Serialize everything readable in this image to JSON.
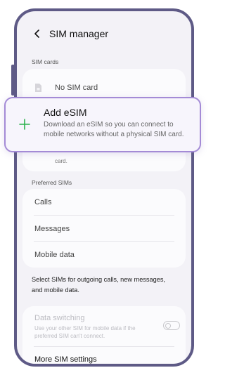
{
  "header": {
    "title": "SIM manager"
  },
  "sim_cards": {
    "section_label": "SIM cards",
    "no_sim_label": "No SIM card",
    "hidden_desc_tail": "card."
  },
  "add_esim": {
    "title": "Add eSIM",
    "description": "Download an eSIM so you can connect to mobile networks without a physical SIM card.",
    "accent_color": "#2bb24c",
    "border_color": "#a48bd6"
  },
  "preferred_sims": {
    "section_label": "Preferred SIMs",
    "items": [
      {
        "label": "Calls"
      },
      {
        "label": "Messages"
      },
      {
        "label": "Mobile data"
      }
    ]
  },
  "note": "Select SIMs for outgoing calls, new messages, and mobile data.",
  "data_switching": {
    "title": "Data switching",
    "description": "Use your other SIM for mobile data if the preferred SIM can't connect.",
    "enabled": false
  },
  "more_settings": {
    "label": "More SIM settings"
  }
}
